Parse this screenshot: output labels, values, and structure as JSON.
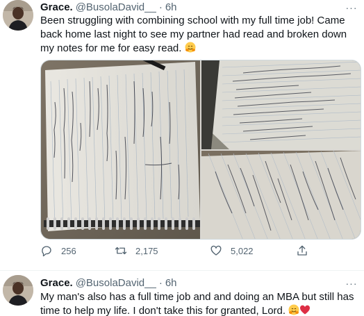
{
  "tweets": [
    {
      "name": "Grace.",
      "handle": "@BusolaDavid__",
      "dot": "·",
      "time": "6h",
      "more": "···",
      "text": "Been struggling with combining school with my full time job! Came back home last night to see my partner had read and broken down my notes for me for easy read.",
      "emoji": "hugging-face-emoji",
      "stats": {
        "replies": "256",
        "retweets": "2,175",
        "likes": "5,022"
      },
      "photos": [
        "handwritten-notes-notebook",
        "handwritten-notes-page",
        "handwritten-notes-page-closeup"
      ]
    },
    {
      "name": "Grace.",
      "handle": "@BusolaDavid__",
      "dot": "·",
      "time": "6h",
      "more": "···",
      "text": "My man's also has a full time job and and doing an MBA but still has time to help my life. I don't take this for granted, Lord.",
      "emojis": [
        "hugging-face-emoji",
        "red-heart-emoji"
      ]
    }
  ],
  "colors": {
    "text": "#0f1419",
    "secondary": "#536471",
    "border": "#cfd9de",
    "emoji_yellow": "#ffcc4d",
    "heart_red": "#dd2e44"
  }
}
